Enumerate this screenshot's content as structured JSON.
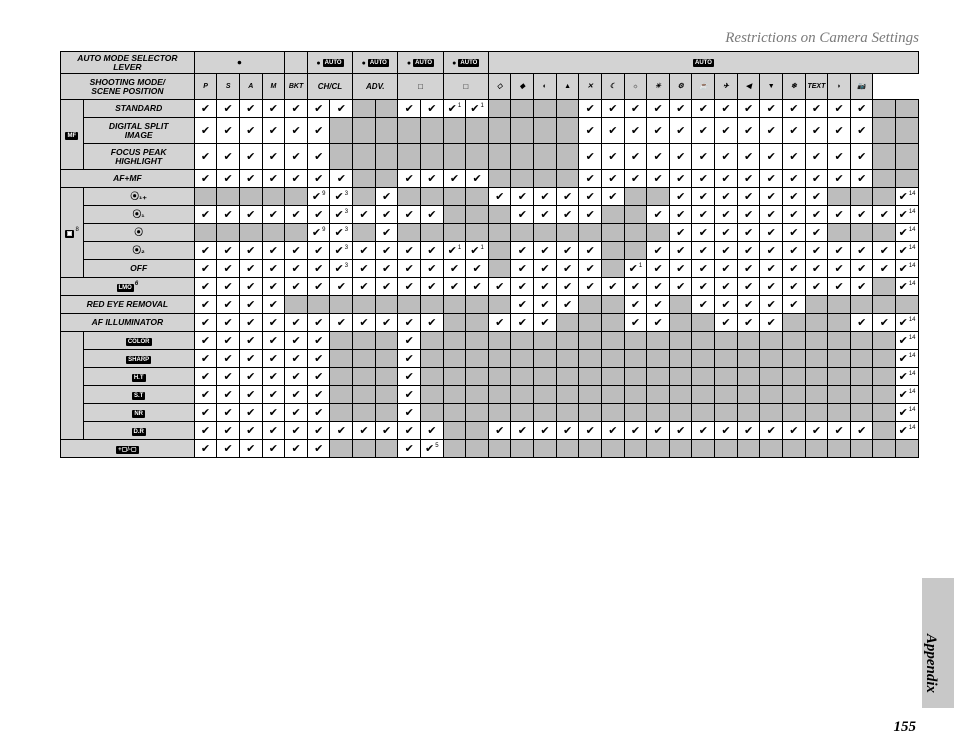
{
  "section_title": "Restrictions on Camera Settings",
  "appendix_label": "Appendix",
  "page_number": "155",
  "headers": {
    "row1": {
      "auto_mode": "Auto mode selector lever",
      "dot": "●",
      "auto": "AUTO"
    },
    "row2": {
      "shooting_mode": "Shooting mode/\nscene position",
      "cols": [
        "P",
        "S",
        "A",
        "M",
        "BKT",
        "CH/CL",
        "Adv.",
        "□",
        "□",
        "◇",
        "◆",
        "◐",
        "▲",
        "✕",
        "☾",
        "☼",
        "☀",
        "⚙",
        "☕",
        "✈",
        "◀",
        "▼",
        "❄",
        "TEXT",
        "◗",
        "📷"
      ]
    }
  },
  "check": "✔",
  "footnotes": {
    "n1": "1",
    "n3": "3",
    "n5": "5",
    "n6": "6",
    "n8": "8",
    "n9": "9",
    "n14": "14"
  },
  "rows": [
    {
      "side_icon": "MF",
      "side_sup": "",
      "side_rowspan": 3,
      "labels": [
        "STANDARD"
      ],
      "cells": [
        "c",
        "c",
        "c",
        "c",
        "c",
        "c",
        "c",
        "s",
        "s",
        "c",
        "c",
        "c1",
        "c1",
        "s",
        "s",
        "s",
        "s",
        "c",
        "c",
        "c",
        "c",
        "c",
        "c",
        "c",
        "c",
        "c",
        "c",
        "c",
        "c",
        "c",
        "s",
        "s"
      ]
    },
    {
      "labels": [
        "DIGITAL SPLIT",
        "IMAGE"
      ],
      "cells": [
        "c",
        "c",
        "c",
        "c",
        "c",
        "c",
        "s",
        "s",
        "s",
        "s",
        "s",
        "s",
        "s",
        "s",
        "s",
        "s",
        "s",
        "c",
        "c",
        "c",
        "c",
        "c",
        "c",
        "c",
        "c",
        "c",
        "c",
        "c",
        "c",
        "c",
        "s",
        "s"
      ]
    },
    {
      "labels": [
        "FOCUS PEAK",
        "HIGHLIGHT"
      ],
      "cells": [
        "c",
        "c",
        "c",
        "c",
        "c",
        "c",
        "s",
        "s",
        "s",
        "s",
        "s",
        "s",
        "s",
        "s",
        "s",
        "s",
        "s",
        "c",
        "c",
        "c",
        "c",
        "c",
        "c",
        "c",
        "c",
        "c",
        "c",
        "c",
        "c",
        "c",
        "s",
        "s"
      ]
    },
    {
      "full_label": "AF+MF",
      "colspan": 2,
      "cells": [
        "c",
        "c",
        "c",
        "c",
        "c",
        "c",
        "c",
        "s",
        "s",
        "c",
        "c",
        "c",
        "c",
        "s",
        "s",
        "s",
        "s",
        "c",
        "c",
        "c",
        "c",
        "c",
        "c",
        "c",
        "c",
        "c",
        "c",
        "c",
        "c",
        "c",
        "s",
        "s"
      ]
    },
    {
      "side_icon": "▣",
      "side_sup": "8",
      "side_rowspan": 5,
      "icon_label": "⦿₁₊",
      "label_sup": "",
      "cells": [
        "s",
        "s",
        "s",
        "s",
        "s",
        "c9",
        "c3",
        "s",
        "c",
        "s",
        "s",
        "s",
        "s",
        "c",
        "c",
        "c",
        "c",
        "c",
        "c",
        "s",
        "s",
        "c",
        "c",
        "c",
        "c",
        "c",
        "c",
        "c",
        "s",
        "s",
        "s",
        "c14"
      ]
    },
    {
      "icon_label": "⦿₁",
      "label_sup": "",
      "cells": [
        "c",
        "c",
        "c",
        "c",
        "c",
        "c",
        "c3",
        "c",
        "c",
        "c",
        "c",
        "s",
        "s",
        "s",
        "c",
        "c",
        "c",
        "c",
        "s",
        "s",
        "c",
        "c",
        "c",
        "c",
        "c",
        "c",
        "c",
        "c",
        "c",
        "c",
        "c",
        "c14"
      ]
    },
    {
      "icon_label": "⦿",
      "label_sup": "",
      "cells": [
        "s",
        "s",
        "s",
        "s",
        "s",
        "c9",
        "c3",
        "s",
        "c",
        "s",
        "s",
        "s",
        "s",
        "s",
        "s",
        "s",
        "s",
        "s",
        "s",
        "s",
        "s",
        "c",
        "c",
        "c",
        "c",
        "c",
        "c",
        "c",
        "s",
        "s",
        "s",
        "c14"
      ]
    },
    {
      "icon_label": "⦿₂",
      "label_sup": "",
      "cells": [
        "c",
        "c",
        "c",
        "c",
        "c",
        "c",
        "c3",
        "c",
        "c",
        "c",
        "c",
        "c1",
        "c1",
        "s",
        "c",
        "c",
        "c",
        "c",
        "s",
        "s",
        "c",
        "c",
        "c",
        "c",
        "c",
        "c",
        "c",
        "c",
        "c",
        "c",
        "c",
        "c14"
      ]
    },
    {
      "labels": [
        "OFF"
      ],
      "cells": [
        "c",
        "c",
        "c",
        "c",
        "c",
        "c",
        "c3",
        "c",
        "c",
        "c",
        "c",
        "c",
        "c",
        "s",
        "c",
        "c",
        "c",
        "c",
        "s",
        "c1",
        "c",
        "c",
        "c",
        "c",
        "c",
        "c",
        "c",
        "c",
        "c",
        "c",
        "c",
        "c14"
      ]
    },
    {
      "full_icon": "LMO",
      "full_sup": "6",
      "colspan": 2,
      "cells": [
        "c",
        "c",
        "c",
        "c",
        "c",
        "c",
        "c",
        "c",
        "c",
        "c",
        "c",
        "c",
        "c",
        "c",
        "c",
        "c",
        "c",
        "c",
        "c",
        "c",
        "c",
        "c",
        "c",
        "c",
        "c",
        "c",
        "c",
        "c",
        "c",
        "c",
        "s",
        "c14"
      ]
    },
    {
      "full_label": "RED EYE REMOVAL",
      "colspan": 2,
      "cells": [
        "c",
        "c",
        "c",
        "c",
        "s",
        "s",
        "s",
        "s",
        "s",
        "s",
        "s",
        "s",
        "s",
        "s",
        "c",
        "c",
        "c",
        "s",
        "s",
        "c",
        "c",
        "s",
        "c",
        "c",
        "c",
        "c",
        "c",
        "s",
        "s",
        "s",
        "s",
        "s"
      ]
    },
    {
      "full_label": "AF ILLUMINATOR",
      "colspan": 2,
      "cells": [
        "c",
        "c",
        "c",
        "c",
        "c",
        "c",
        "c",
        "c",
        "c",
        "c",
        "c",
        "s",
        "s",
        "c",
        "c",
        "c",
        "s",
        "s",
        "s",
        "c",
        "c",
        "s",
        "s",
        "c",
        "c",
        "c",
        "s",
        "s",
        "s",
        "c",
        "c",
        "c14"
      ]
    },
    {
      "side_blank": true,
      "side_rowspan": 6,
      "icon_box": "Color",
      "cells": [
        "c",
        "c",
        "c",
        "c",
        "c",
        "c",
        "s",
        "s",
        "s",
        "c",
        "s",
        "s",
        "s",
        "s",
        "s",
        "s",
        "s",
        "s",
        "s",
        "s",
        "s",
        "s",
        "s",
        "s",
        "s",
        "s",
        "s",
        "s",
        "s",
        "s",
        "s",
        "c14"
      ]
    },
    {
      "icon_box": "Sharp",
      "cells": [
        "c",
        "c",
        "c",
        "c",
        "c",
        "c",
        "s",
        "s",
        "s",
        "c",
        "s",
        "s",
        "s",
        "s",
        "s",
        "s",
        "s",
        "s",
        "s",
        "s",
        "s",
        "s",
        "s",
        "s",
        "s",
        "s",
        "s",
        "s",
        "s",
        "s",
        "s",
        "c14"
      ]
    },
    {
      "icon_box": "H.T",
      "cells": [
        "c",
        "c",
        "c",
        "c",
        "c",
        "c",
        "s",
        "s",
        "s",
        "c",
        "s",
        "s",
        "s",
        "s",
        "s",
        "s",
        "s",
        "s",
        "s",
        "s",
        "s",
        "s",
        "s",
        "s",
        "s",
        "s",
        "s",
        "s",
        "s",
        "s",
        "s",
        "c14"
      ]
    },
    {
      "icon_box": "S.T",
      "cells": [
        "c",
        "c",
        "c",
        "c",
        "c",
        "c",
        "s",
        "s",
        "s",
        "c",
        "s",
        "s",
        "s",
        "s",
        "s",
        "s",
        "s",
        "s",
        "s",
        "s",
        "s",
        "s",
        "s",
        "s",
        "s",
        "s",
        "s",
        "s",
        "s",
        "s",
        "s",
        "c14"
      ]
    },
    {
      "icon_box": "NR",
      "cells": [
        "c",
        "c",
        "c",
        "c",
        "c",
        "c",
        "s",
        "s",
        "s",
        "c",
        "s",
        "s",
        "s",
        "s",
        "s",
        "s",
        "s",
        "s",
        "s",
        "s",
        "s",
        "s",
        "s",
        "s",
        "s",
        "s",
        "s",
        "s",
        "s",
        "s",
        "s",
        "c14"
      ]
    },
    {
      "icon_box": "D.R",
      "cells": [
        "c",
        "c",
        "c",
        "c",
        "c",
        "c",
        "c",
        "c",
        "c",
        "c",
        "c",
        "s",
        "s",
        "c",
        "c",
        "c",
        "c",
        "c",
        "c",
        "c",
        "c",
        "c",
        "c",
        "c",
        "c",
        "c",
        "c",
        "c",
        "c",
        "c",
        "s",
        "c14"
      ]
    },
    {
      "full_icon": "+▢/-▢",
      "colspan": 2,
      "cells": [
        "c",
        "c",
        "c",
        "c",
        "c",
        "c",
        "s",
        "s",
        "s",
        "c",
        "c5",
        "s",
        "s",
        "s",
        "s",
        "s",
        "s",
        "s",
        "s",
        "s",
        "s",
        "s",
        "s",
        "s",
        "s",
        "s",
        "s",
        "s",
        "s",
        "s",
        "s",
        "s"
      ]
    }
  ]
}
